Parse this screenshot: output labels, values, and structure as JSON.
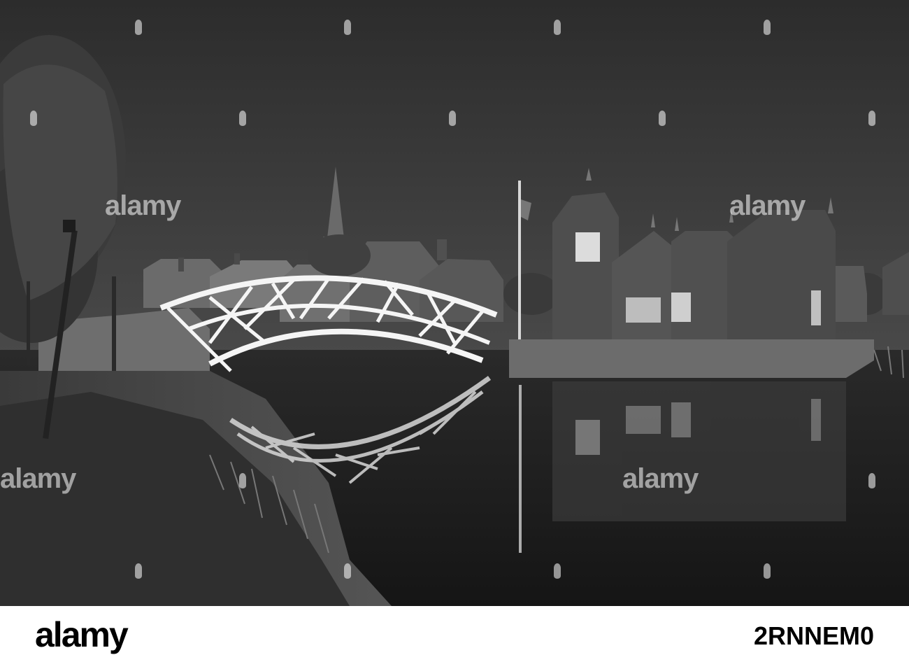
{
  "watermark": {
    "text": "alamy"
  },
  "footer": {
    "logo": "alamy",
    "image_id": "2RNNEM0"
  },
  "photo": {
    "style": "black-and-white",
    "icons": [
      "watermark-drop-icon"
    ]
  }
}
